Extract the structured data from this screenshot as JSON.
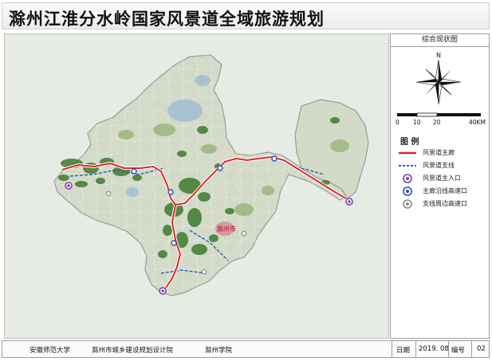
{
  "title": "滁州江淮分水岭国家风景道全域旅游规划",
  "panel": {
    "title": "综合现状图",
    "compass_label": "N",
    "scale_ticks": [
      "0",
      "10",
      "20",
      "40KM"
    ]
  },
  "legend": {
    "title": "图 例",
    "items": [
      {
        "label": "风景道主廊",
        "icon": "red-line"
      },
      {
        "label": "风景道支线",
        "icon": "blue-dashed-line"
      },
      {
        "label": "风景道主入口",
        "icon": "purple-circle-icon"
      },
      {
        "label": "主廊沿线高速口",
        "icon": "blue-circle-icon"
      },
      {
        "label": "支线周边高速口",
        "icon": "grey-circle-icon"
      }
    ]
  },
  "map": {
    "city_label": "滁州市"
  },
  "footer": {
    "org1": "安徽师范大学",
    "org2": "滁州市城乡建设规划设计院",
    "org3": "滁州学院",
    "date_label": "日期",
    "date_value": "2019. 08",
    "number_label": "编号",
    "number_value": "02"
  },
  "colors": {
    "main_corridor": "#d9292b",
    "branch_line": "#3556b8",
    "region_fill": "#d4dbc9",
    "forest": "#3e7a2f",
    "water": "#8fb0c6"
  }
}
